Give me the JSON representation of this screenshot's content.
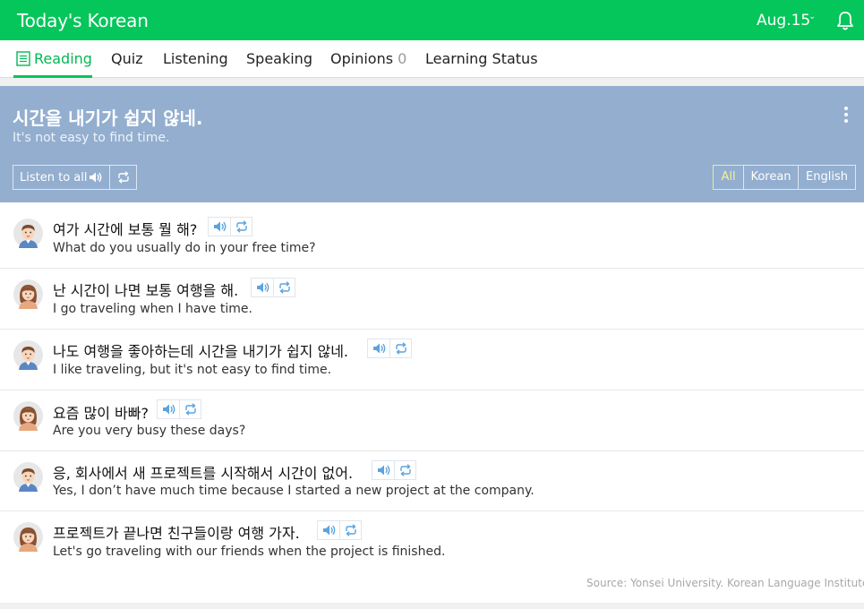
{
  "header": {
    "app_title": "Today's Korean",
    "date": "Aug.15",
    "date_chevron": "⌄",
    "bell_icon": "bell-icon",
    "brand_color": "#04c65a"
  },
  "tabs": [
    {
      "label": "Reading",
      "icon": "document-icon",
      "active": true
    },
    {
      "label": "Quiz"
    },
    {
      "label": "Listening"
    },
    {
      "label": "Speaking"
    },
    {
      "label": "Opinions",
      "count": "0"
    },
    {
      "label": "Learning Status"
    }
  ],
  "hero": {
    "korean": "시간을 내기가 쉽지 않네.",
    "english": "It's not easy to find time.",
    "listen_all_label": "Listen to all",
    "filters": [
      "All",
      "Korean",
      "English"
    ],
    "active_filter": "All",
    "background_color": "#93aecf"
  },
  "dialogue": [
    {
      "korean": "여가 시간에 보통 뭘 해?",
      "english": "What do you usually do in your free time?",
      "speaker": "man"
    },
    {
      "korean": "난 시간이 나면 보통 여행을 해.",
      "english": "I go traveling when I have time.",
      "speaker": "woman"
    },
    {
      "korean": "나도 여행을 좋아하는데 시간을 내기가 쉽지 않네.",
      "english": "I like traveling, but it's not easy to find time.",
      "speaker": "man"
    },
    {
      "korean": "요즘 많이 바빠?",
      "english": "Are you very busy these days?",
      "speaker": "woman"
    },
    {
      "korean": "응, 회사에서 새 프로젝트를 시작해서 시간이 없어.",
      "english": "Yes, I don’t have much time because I started a new project at the company.",
      "speaker": "man"
    },
    {
      "korean": "프로젝트가 끝나면 친구들이랑 여행 가자.",
      "english": "Let's go traveling with our friends when the project is finished.",
      "speaker": "woman"
    }
  ],
  "footer": {
    "source": "Source: Yonsei University. Korean Language Institute"
  }
}
